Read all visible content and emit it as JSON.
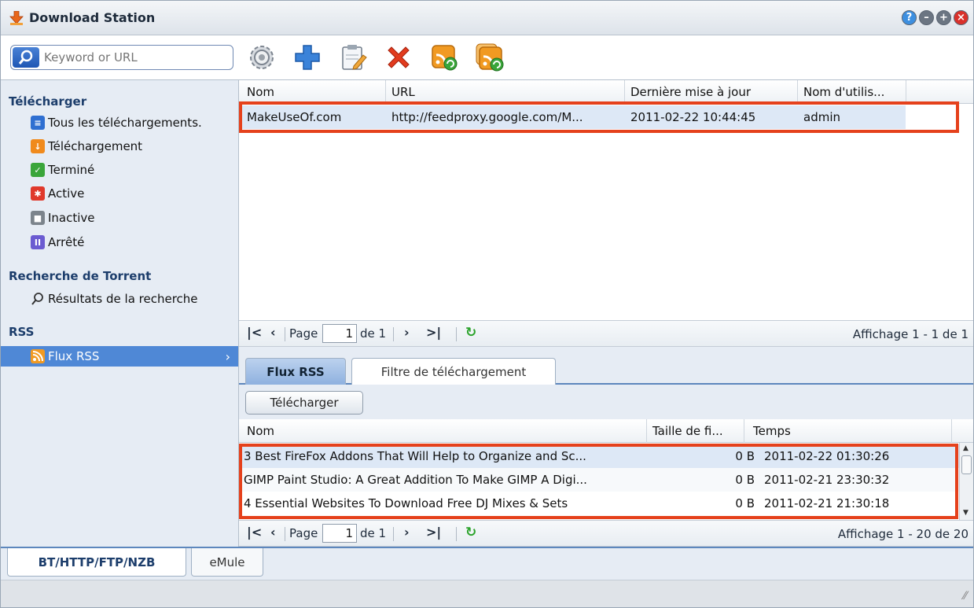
{
  "app": {
    "title": "Download Station"
  },
  "window_buttons": [
    "help-icon",
    "minimize-icon",
    "maximize-icon",
    "close-icon"
  ],
  "search": {
    "placeholder": "Keyword or URL"
  },
  "toolbar": [
    "settings-icon",
    "add-icon",
    "edit-icon",
    "delete-icon",
    "rss-refresh-icon",
    "rss-refresh-all-icon"
  ],
  "sidebar": {
    "download_section": "Télécharger",
    "download_items": [
      {
        "label": "Tous les téléchargements.",
        "icon": "list-icon",
        "color": "#2f6fd1"
      },
      {
        "label": "Téléchargement",
        "icon": "download-icon",
        "color": "#f08a1c"
      },
      {
        "label": "Terminé",
        "icon": "check-icon",
        "color": "#3aa53a"
      },
      {
        "label": "Active",
        "icon": "active-icon",
        "color": "#e0392b"
      },
      {
        "label": "Inactive",
        "icon": "inactive-icon",
        "color": "#7c848c"
      },
      {
        "label": "Arrêté",
        "icon": "pause-icon",
        "color": "#6b5bd1"
      }
    ],
    "torrent_section": "Recherche de Torrent",
    "torrent_items": [
      {
        "label": "Résultats de la recherche",
        "icon": "search-icon"
      }
    ],
    "rss_section": "RSS",
    "rss_items": [
      {
        "label": "Flux RSS",
        "icon": "rss-icon"
      }
    ]
  },
  "feeds_grid": {
    "columns": [
      "Nom",
      "URL",
      "Dernière mise à jour",
      "Nom d'utilis..."
    ],
    "rows": [
      {
        "name": "MakeUseOf.com",
        "url": "http://feedproxy.google.com/M...",
        "updated": "2011-02-22 10:44:45",
        "user": "admin"
      }
    ]
  },
  "pager_top": {
    "page_label": "Page",
    "page": "1",
    "of": "de 1",
    "info": "Affichage 1 - 1 de 1"
  },
  "tabs": [
    "Flux RSS",
    "Filtre de téléchargement"
  ],
  "download_button": "Télécharger",
  "items_grid": {
    "columns": [
      "Nom",
      "Taille de fi...",
      "Temps"
    ],
    "rows": [
      {
        "name": "3 Best FireFox Addons That Will Help to Organize and Sc...",
        "size": "0 B",
        "time": "2011-02-22 01:30:26"
      },
      {
        "name": "GIMP Paint Studio: A Great Addition To Make GIMP A Digi...",
        "size": "0 B",
        "time": "2011-02-21 23:30:32"
      },
      {
        "name": "4 Essential Websites To Download Free DJ Mixes & Sets",
        "size": "0 B",
        "time": "2011-02-21 21:30:18"
      }
    ]
  },
  "pager_bottom": {
    "page_label": "Page",
    "page": "1",
    "of": "de 1",
    "info": "Affichage 1 - 20 de 20"
  },
  "bottom_tabs": [
    "BT/HTTP/FTP/NZB",
    "eMule"
  ],
  "colors": {
    "highlight": "#e5411c",
    "selection": "#4f88d6",
    "accent": "#1c3d6b"
  }
}
